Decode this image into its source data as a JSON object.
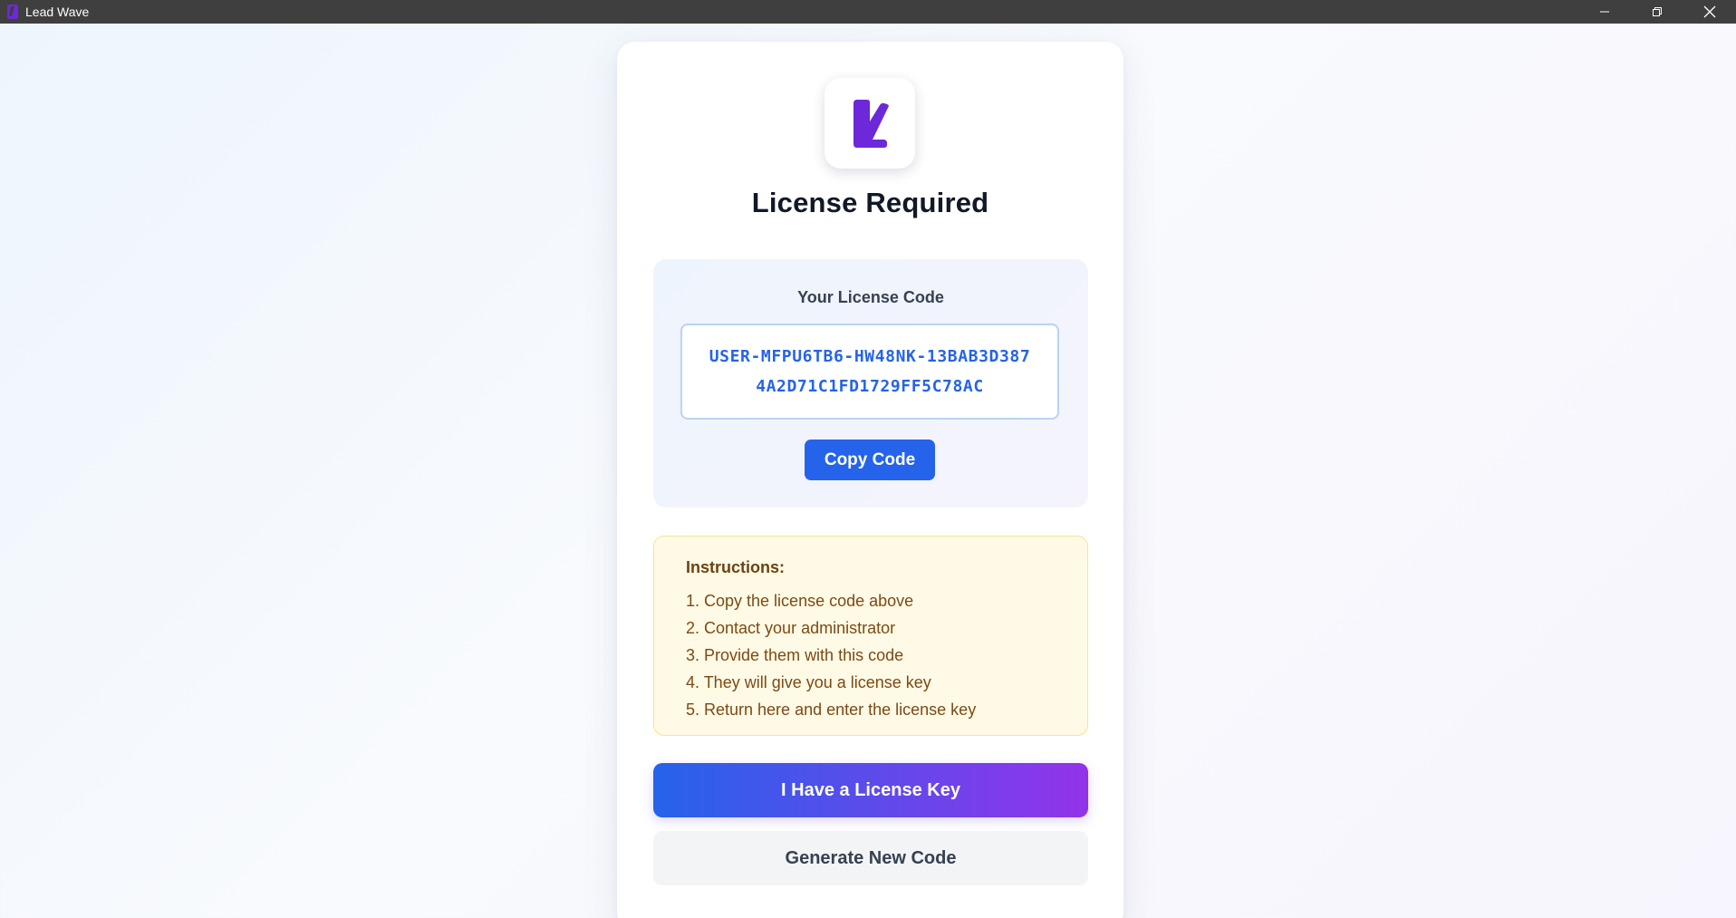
{
  "window": {
    "title": "Lead Wave",
    "app_icon": "lead-wave-logo-icon",
    "controls": [
      "minimize-icon",
      "restore-icon",
      "close-icon"
    ]
  },
  "page": {
    "title": "License Required",
    "logo_icon": "lead-wave-logo-icon"
  },
  "license": {
    "label": "Your License Code",
    "code_line_1": "USER-MFPU6TB6-HW48NK-13BAB3D387",
    "code_line_2": "4A2D71C1FD1729FF5C78AC",
    "copy_button": "Copy Code"
  },
  "instructions": {
    "title": "Instructions:",
    "steps": [
      "1. Copy the license code above",
      "2. Contact your administrator",
      "3. Provide them with this code",
      "4. They will give you a license key",
      "5. Return here and enter the license key"
    ]
  },
  "actions": {
    "have_key": "I Have a License Key",
    "generate": "Generate New Code"
  },
  "colors": {
    "accent_blue": "#2563eb",
    "accent_purple": "#9333ea",
    "logo_purple": "#6d28d9",
    "titlebar": "#3f3f3f"
  }
}
